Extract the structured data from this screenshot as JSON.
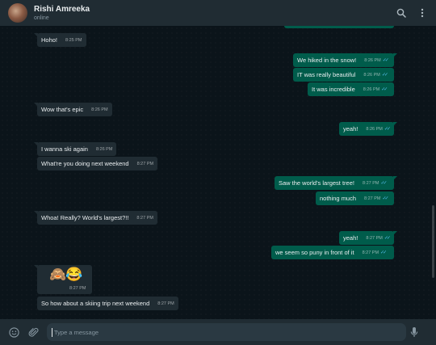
{
  "header": {
    "name": "Rishi Amreeka",
    "status": "online"
  },
  "messages": [
    {
      "dir": "in",
      "text": "Hoho!",
      "time": "8:25 PM"
    },
    {
      "dir": "out",
      "text": "We hiked in the snow!",
      "time": "8:26 PM"
    },
    {
      "dir": "out",
      "text": "IT was really beautiful",
      "time": "8:26 PM"
    },
    {
      "dir": "out",
      "text": "It was incredible",
      "time": "8:26 PM"
    },
    {
      "dir": "in",
      "text": "Wow that's epic",
      "time": "8:26 PM"
    },
    {
      "dir": "out",
      "text": "yeah!",
      "time": "8:26 PM"
    },
    {
      "dir": "in",
      "text": "I wanna ski again",
      "time": "8:26 PM"
    },
    {
      "dir": "in",
      "text": "What're you doing next weekend",
      "time": "8:27 PM"
    },
    {
      "dir": "out",
      "text": "Saw the world's largest tree!",
      "time": "8:27 PM"
    },
    {
      "dir": "out",
      "text": "nothing much",
      "time": "8:27 PM"
    },
    {
      "dir": "in",
      "text": "Whoa! Really? World's largest?!!",
      "time": "8:27 PM"
    },
    {
      "dir": "out",
      "text": "yeah!",
      "time": "8:27 PM"
    },
    {
      "dir": "out",
      "text": "we seem so puny in front of it",
      "time": "8:27 PM"
    },
    {
      "dir": "in",
      "text": "🙈😂",
      "time": "8:27 PM",
      "emoji": [
        "🙈",
        "😂"
      ]
    },
    {
      "dir": "in",
      "text": "So how about a skiing trip next weekend",
      "time": "8:27 PM"
    }
  ],
  "composer": {
    "placeholder": "Type a message"
  },
  "colors": {
    "header_bg": "#202c33",
    "chat_bg": "#0b141a",
    "incoming_bubble": "#202c33",
    "outgoing_bubble": "#005c4b",
    "read_ticks": "#53bdeb"
  },
  "icons": {
    "search": "search-icon",
    "menu": "kebab-menu-icon",
    "emoji": "emoji-icon",
    "attach": "paperclip-icon",
    "mic": "microphone-icon"
  }
}
